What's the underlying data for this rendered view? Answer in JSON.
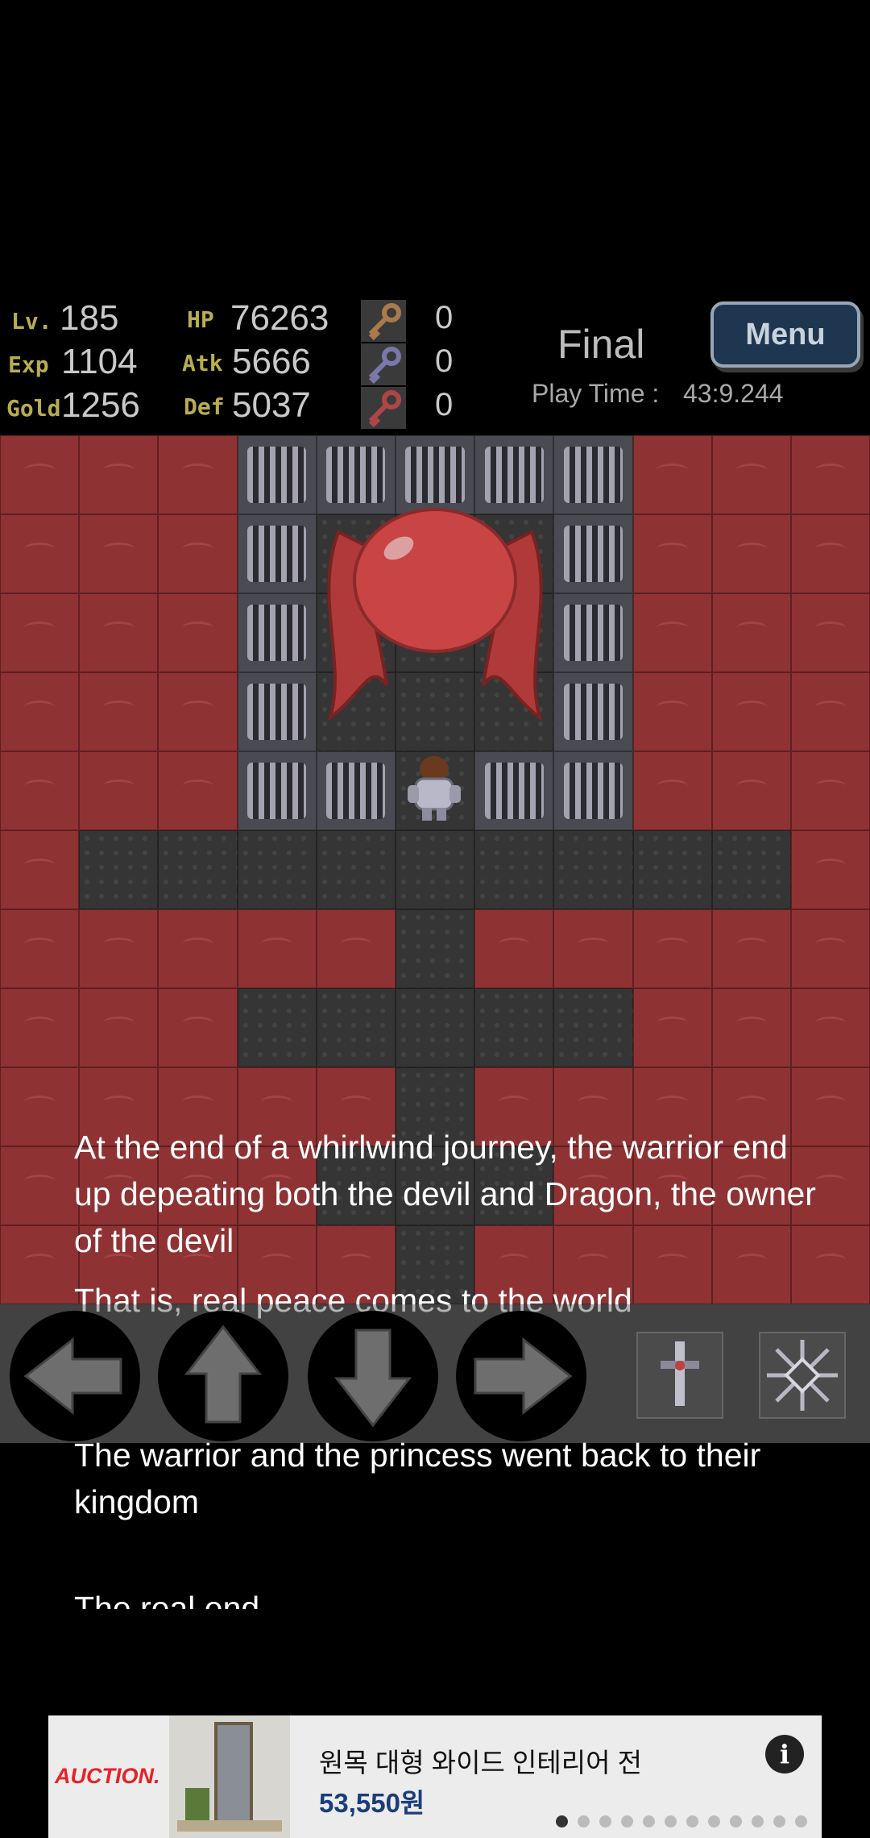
{
  "hud": {
    "level_label": "Lv.",
    "level": "185",
    "exp_label": "Exp",
    "exp": "1104",
    "gold_label": "Gold",
    "gold": "1256",
    "hp_label": "HP",
    "hp": "76263",
    "atk_label": "Atk",
    "atk": "5666",
    "def_label": "Def",
    "def": "5037",
    "keys": [
      {
        "icon": "yellow-key-icon",
        "color": "#a97a4a",
        "count": "0"
      },
      {
        "icon": "blue-key-icon",
        "color": "#7a78a8",
        "count": "0"
      },
      {
        "icon": "red-key-icon",
        "color": "#b04545",
        "count": "0"
      }
    ],
    "floor_name": "Final",
    "playtime_label": "Play Time :",
    "playtime_value": "43:9.244",
    "menu_label": "Menu"
  },
  "map": {
    "rows": [
      "LLLBBBBBLLL",
      "LLLBFFFBLLL",
      "LLLBFFFBLLL",
      "LLLBFFFBLLL",
      "LLLBBFBBLLL",
      "LFFFFFFFFFL",
      "LLLLLFLLLLL",
      "LLLFFFFFLLL",
      "LLLLLFLLLLL",
      "LLLLFFFLLLL",
      "LLLLLFLLLLL"
    ],
    "boss": "red-dragon",
    "player": "armored-warrior"
  },
  "story": {
    "p1": "At the end of a whirlwind journey, the warrior end up depeating both the devil and Dragon, the owner of the devil",
    "p2": "That is, real peace comes to the world",
    "p3": "The warrior and the princess went back to their kingdom",
    "p4": "The real end"
  },
  "controls": {
    "left": "arrow-left-icon",
    "up": "arrow-up-icon",
    "down": "arrow-down-icon",
    "right": "arrow-right-icon",
    "item1": "sword-item-icon",
    "item2": "snowflake-item-icon"
  },
  "ad": {
    "brand": "AUCTION.",
    "title": "원목 대형 와이드 인테리어 전",
    "price": "53,550원",
    "info_glyph": "i",
    "dots_total": 12,
    "dots_active": 0
  }
}
